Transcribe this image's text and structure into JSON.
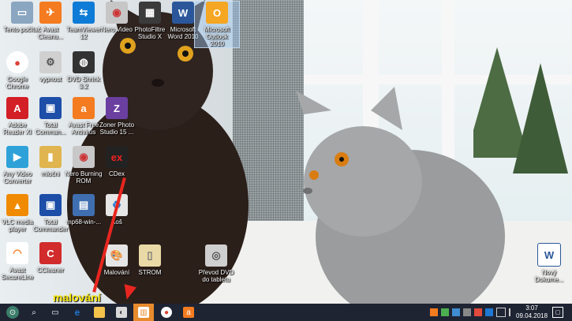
{
  "desktop": {
    "icons": [
      {
        "id": "tento-pocitac",
        "label": "Tento počítač",
        "color": "#8aa6c1",
        "glyph": "▭"
      },
      {
        "id": "avast-cleanup",
        "label": "Avast\nCleanu...",
        "color": "#f47b20",
        "glyph": "✈"
      },
      {
        "id": "teamviewer",
        "label": "TeamViewer\n12",
        "color": "#0e7bd6",
        "glyph": "⇆"
      },
      {
        "id": "nero-video",
        "label": "Nero Video",
        "color": "#c6c6c6",
        "glyph": "◉"
      },
      {
        "id": "photofiltre",
        "label": "PhotoFiltre\nStudio X",
        "color": "#3b3b3b",
        "glyph": "▦"
      },
      {
        "id": "word-2010",
        "label": "Microsoft\nWord 2010",
        "color": "#2b579a",
        "glyph": "W"
      },
      {
        "id": "outlook-2010",
        "label": "Microsoft\nOutlook\n2010",
        "color": "#f5a623",
        "glyph": "O"
      },
      {
        "id": "chrome",
        "label": "Google\nChrome",
        "color": "#db4437",
        "glyph": "●"
      },
      {
        "id": "vypnout",
        "label": "vypnout",
        "color": "#d0d0d0",
        "glyph": "⚙"
      },
      {
        "id": "dvd-shrink",
        "label": "DVD Shrink\n3.2",
        "color": "#333333",
        "glyph": "◍"
      },
      {
        "id": "adobe-reader",
        "label": "Adobe\nReader XI",
        "color": "#d31f26",
        "glyph": "A"
      },
      {
        "id": "total-commander",
        "label": "Total\nComman...",
        "color": "#1d4ea8",
        "glyph": "▣"
      },
      {
        "id": "avast-free",
        "label": "Avast Free\nAntivirus",
        "color": "#f47b20",
        "glyph": "a"
      },
      {
        "id": "zoner",
        "label": "Zoner Photo\nStudio 15 ...",
        "color": "#6a3fa0",
        "glyph": "Z"
      },
      {
        "id": "any-video",
        "label": "Any Video\nConverter",
        "color": "#2ea2d8",
        "glyph": "▶"
      },
      {
        "id": "mlocni",
        "label": "mločni",
        "color": "#e0b550",
        "glyph": "▮"
      },
      {
        "id": "nero-burning",
        "label": "Nero Burning\nROM",
        "color": "#c8c8c8",
        "glyph": "◉"
      },
      {
        "id": "cdex",
        "label": "CDex",
        "color": "#222222",
        "glyph": "ex"
      },
      {
        "id": "vlc",
        "label": "VLC media\nplayer",
        "color": "#f08a00",
        "glyph": "▲"
      },
      {
        "id": "total-commander-2",
        "label": "Total\nCommander",
        "color": "#1d4ea8",
        "glyph": "▣"
      },
      {
        "id": "mp68",
        "label": "mp68-win-...",
        "color": "#3f6fb0",
        "glyph": "▤"
      },
      {
        "id": "kos",
        "label": "Koš",
        "color": "#e6e6e6",
        "glyph": "♻"
      },
      {
        "id": "avast-secureline",
        "label": "Avast\nSecureLine",
        "color": "#f47b20",
        "glyph": "◠"
      },
      {
        "id": "ccleaner",
        "label": "CCleaner",
        "color": "#d12b2b",
        "glyph": "C"
      },
      {
        "id": "malovani",
        "label": "Malování",
        "color": "#e5e5e5",
        "glyph": "🎨"
      },
      {
        "id": "strom",
        "label": "STROM",
        "color": "#e9d9a6",
        "glyph": "▯"
      },
      {
        "id": "prevod-dvd",
        "label": "Převod DVD\ndo tabletu",
        "color": "#cfcfcf",
        "glyph": "◎"
      },
      {
        "id": "novy-dokument",
        "label": "Nový\nDokume...",
        "color": "#2b579a",
        "glyph": "W"
      }
    ],
    "annotation": "malování"
  },
  "taskbar": {
    "items": [
      {
        "id": "start",
        "glyph": "⊙",
        "color": "#3a7d6a"
      },
      {
        "id": "search",
        "glyph": "⌕",
        "color": "transparent"
      },
      {
        "id": "task-view",
        "glyph": "▭",
        "color": "transparent"
      },
      {
        "id": "edge",
        "glyph": "e",
        "color": "#1f78d1"
      },
      {
        "id": "explorer",
        "glyph": "▬",
        "color": "#f3c34b"
      },
      {
        "id": "paint",
        "glyph": "◐",
        "color": "#d9d9d9"
      },
      {
        "id": "active-app",
        "glyph": "▥",
        "color": "#ffffff"
      },
      {
        "id": "chrome",
        "glyph": "●",
        "color": "#db4437"
      },
      {
        "id": "avast",
        "glyph": "a",
        "color": "#f47b20"
      }
    ],
    "clock_time": "3:07",
    "clock_date": "09.04.2018",
    "notification_glyph": "▢"
  }
}
